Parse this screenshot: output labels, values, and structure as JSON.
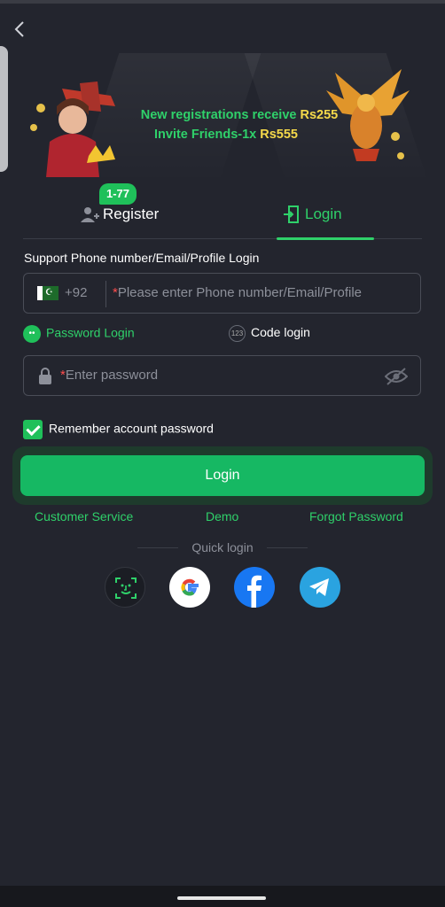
{
  "banner": {
    "line1_text": "New registrations receive ",
    "line1_amount": "Rs255",
    "line2_text": "Invite Friends-1x ",
    "line2_amount": "Rs555"
  },
  "tabs": {
    "register_label": "Register",
    "register_badge": "1-77",
    "login_label": "Login",
    "active": "login"
  },
  "form": {
    "support_text": "Support Phone number/Email/Profile Login",
    "country_code": "+92",
    "phone_placeholder": "Please enter Phone number/Email/Profile",
    "required_mark": "*",
    "password_mode_label": "Password Login",
    "code_mode_label": "Code login",
    "code_mode_icon_text": "123",
    "password_placeholder": "Enter password",
    "remember_label": "Remember account password",
    "remember_checked": true,
    "login_button": "Login"
  },
  "links": {
    "customer_service": "Customer Service",
    "demo": "Demo",
    "forgot_password": "Forgot Password"
  },
  "quick_login": {
    "title": "Quick login",
    "providers": [
      "face-id-icon",
      "google-icon",
      "facebook-icon",
      "telegram-icon"
    ]
  },
  "colors": {
    "background": "#23252e",
    "accent_green": "#2fd16a",
    "button_green": "#16b863",
    "amount_yellow": "#f5d94a"
  }
}
